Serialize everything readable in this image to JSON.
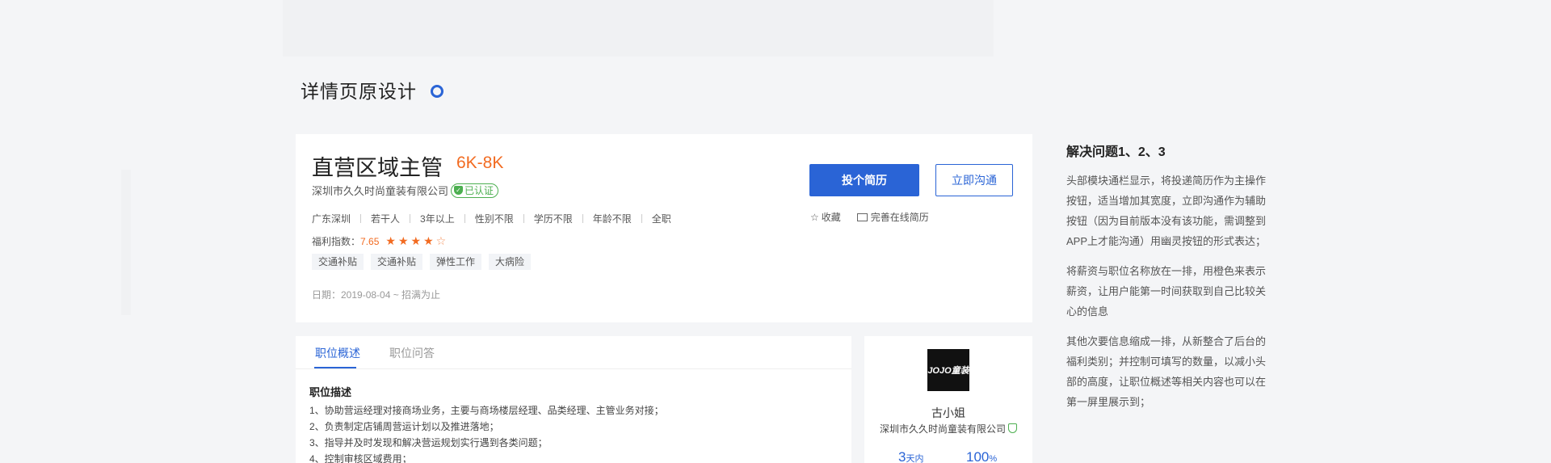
{
  "page_title": "详情页原设计",
  "job": {
    "title": "直营区域主管",
    "salary": "6K-8K",
    "company": "深圳市久久时尚童装有限公司",
    "cert_badge": "已认证",
    "requirements": [
      "广东深圳",
      "若干人",
      "3年以上",
      "性别不限",
      "学历不限",
      "年龄不限",
      "全职"
    ],
    "welfare_label": "福利指数：",
    "welfare_score": "7.65",
    "welfare_stars": 4,
    "welfare_stars_max": 5,
    "tags": [
      "交通补贴",
      "交通补贴",
      "弹性工作",
      "大病险"
    ],
    "date": "日期：2019-08-04 ~ 招满为止"
  },
  "actions": {
    "apply": "投个简历",
    "chat": "立即沟通",
    "favorite": "收藏",
    "complete_resume": "完善在线简历"
  },
  "tabs": [
    "职位概述",
    "职位问答"
  ],
  "active_tab": 0,
  "description": {
    "heading": "职位描述",
    "items": [
      "1、协助营运经理对接商场业务，主要与商场楼层经理、品类经理、主管业务对接；",
      "2、负责制定店铺周营运计划以及推进落地；",
      "3、指导并及时发现和解决营运规划实行遇到各类问题；",
      "4、控制审核区域费用；"
    ]
  },
  "company_card": {
    "logo_text": "JOJO童装",
    "contact": "古小姐",
    "company": "深圳市久久时尚童装有限公司",
    "stat1_value": "3",
    "stat1_unit": "天内",
    "stat2_value": "100",
    "stat2_unit": "%"
  },
  "notes": {
    "title": "解决问题1、2、3",
    "paragraphs": [
      "头部模块通栏显示，将投递简历作为主操作按钮，适当增加其宽度，立即沟通作为辅助按钮（因为目前版本没有该功能，需调整到APP上才能沟通）用幽灵按钮的形式表达；",
      "将薪资与职位名称放在一排，用橙色来表示薪资，让用户能第一时间获取到自己比较关心的信息",
      "其他次要信息缩成一排，从新整合了后台的福利类别；并控制可填写的数量，以减小头部的高度，让职位概述等相关内容也可以在第一屏里展示到；"
    ]
  },
  "colors": {
    "primary": "#2a64d6",
    "salary": "#f26b21",
    "verified": "#4caf50",
    "background": "#f4f5f7"
  }
}
